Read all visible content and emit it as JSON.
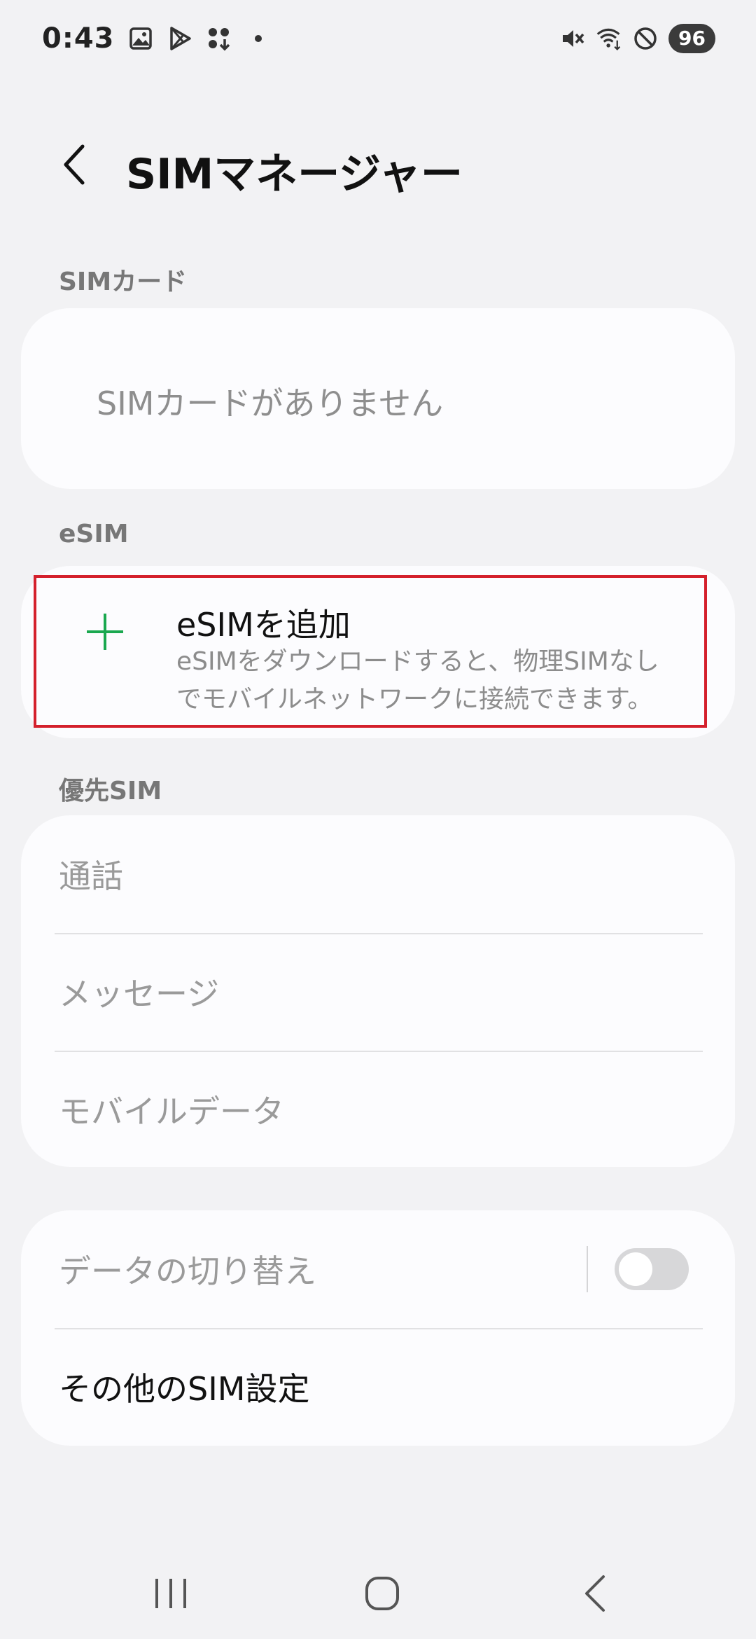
{
  "status_bar": {
    "time": "0:43",
    "battery": "96",
    "icons_left": [
      "gallery-icon",
      "play-store-icon",
      "app-download-icon",
      "dot-icon"
    ],
    "icons_right": [
      "mute-icon",
      "wifi-icon",
      "do-not-disturb-icon"
    ]
  },
  "header": {
    "title": "SIMマネージャー",
    "back_icon": "chevron-left-icon"
  },
  "sections": {
    "sim_card": {
      "label": "SIMカード",
      "empty_text": "SIMカードがありません"
    },
    "esim": {
      "label": "eSIM",
      "add_title": "eSIMを追加",
      "add_desc_line1": "eSIMをダウンロードすると、物理SIMなし",
      "add_desc_line2": "でモバイルネットワークに接続できます。",
      "accent_color": "#1aa84f"
    },
    "preferred_sim": {
      "label": "優先SIM",
      "items": [
        "通話",
        "メッセージ",
        "モバイルデータ"
      ]
    },
    "other": {
      "data_switch_label": "データの切り替え",
      "data_switch_on": false,
      "more_settings_label": "その他のSIM設定"
    }
  },
  "nav_bar": {
    "recent_icon": "recent-apps-icon",
    "home_icon": "home-icon",
    "back_icon": "back-icon"
  },
  "colors": {
    "highlight": "#d4202c",
    "background": "#f2f2f4",
    "card": "#fcfcfe"
  }
}
